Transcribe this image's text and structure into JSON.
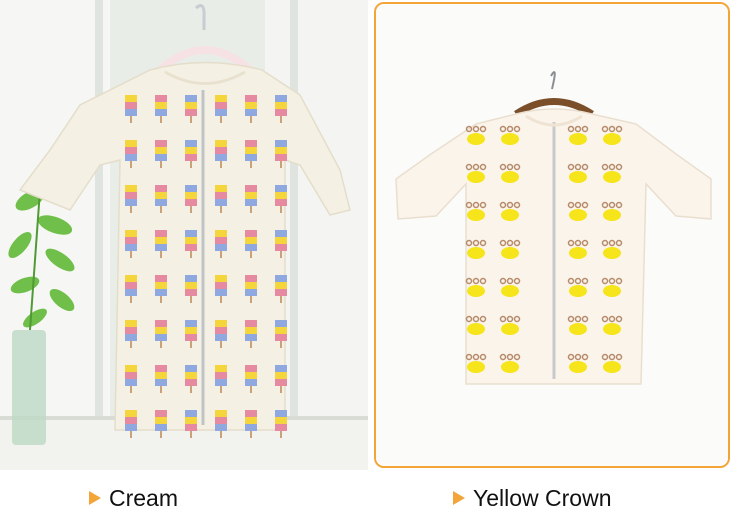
{
  "products": [
    {
      "caption": "Cream",
      "color_hex": "#f5f0e4"
    },
    {
      "caption": "Yellow Crown",
      "color_hex": "#fbf4ea"
    }
  ],
  "colors": {
    "accent": "#f3a53a",
    "crown_yellow": "#f5e51a",
    "dot_brown": "#b68a6a"
  },
  "icons": [
    "arrow-right-icon",
    "hanger-icon",
    "plant-icon",
    "zipper-icon"
  ]
}
